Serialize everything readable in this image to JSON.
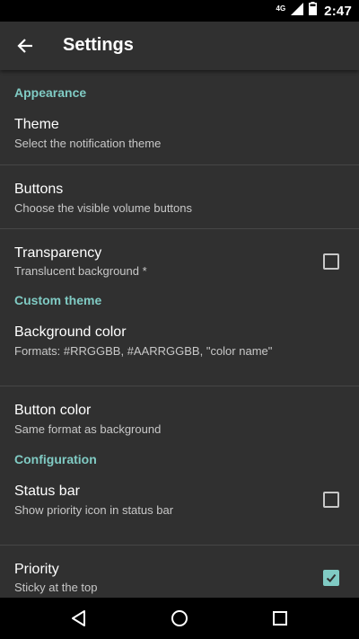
{
  "status_bar": {
    "network": "4G",
    "time": "2:47",
    "icons": [
      "signal-icon",
      "battery-icon"
    ]
  },
  "app_bar": {
    "title": "Settings",
    "back_icon": "arrow-back-icon"
  },
  "sections": [
    {
      "header": "Appearance",
      "items": [
        {
          "title": "Theme",
          "summary": "Select the notification theme"
        },
        {
          "title": "Buttons",
          "summary": "Choose the visible volume buttons"
        },
        {
          "title": "Transparency",
          "summary": "Translucent background *",
          "checkbox": false
        }
      ]
    },
    {
      "header": "Custom theme",
      "items": [
        {
          "title": "Background color",
          "summary": "Formats: #RRGGBB, #AARRGGBB, \"color name\""
        },
        {
          "title": "Button color",
          "summary": "Same format as background"
        }
      ]
    },
    {
      "header": "Configuration",
      "items": [
        {
          "title": "Status bar",
          "summary": "Show priority icon in status bar",
          "checkbox": false
        },
        {
          "title": "Priority",
          "summary": "Sticky at the top",
          "checkbox": true
        }
      ]
    }
  ],
  "nav_bar": {
    "icons": [
      "back-triangle-icon",
      "home-circle-icon",
      "recents-square-icon"
    ]
  },
  "colors": {
    "accent": "#80cbc4",
    "background": "#303030",
    "divider": "#464646"
  }
}
